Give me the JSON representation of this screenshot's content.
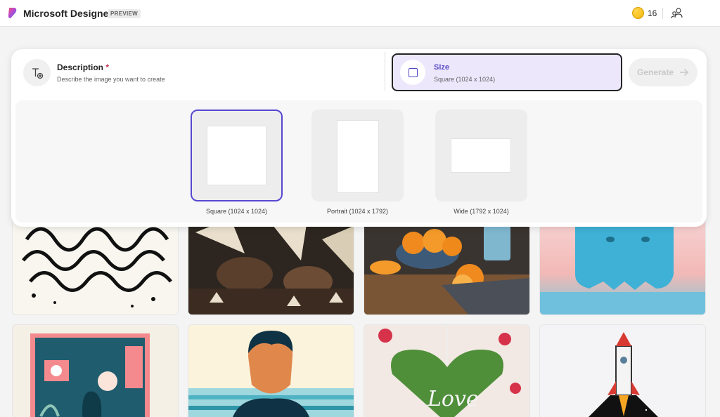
{
  "header": {
    "app_title": "Microsoft Designer",
    "badge": "PREVIEW",
    "credits": "16",
    "brand_color": "#5b4ec4"
  },
  "prompt": {
    "description_label": "Description",
    "required_mark": "*",
    "description_hint": "Describe the image you want to create",
    "size_label": "Size",
    "size_value": "Square (1024 x 1024)",
    "generate_label": "Generate"
  },
  "size_options": [
    {
      "label": "Square (1024 x 1024)",
      "selected": true
    },
    {
      "label": "Portrait (1024 x 1792)",
      "selected": false
    },
    {
      "label": "Wide (1792 x 1024)",
      "selected": false
    }
  ],
  "gallery": {
    "items": [
      "black-white-swirl-pattern",
      "coffee-leaves-art",
      "oranges-bowl-table",
      "blue-clay-creature",
      "folk-art-cat-poster",
      "surfer-man-illustration",
      "love-heart-floral",
      "pixel-rocket"
    ]
  }
}
